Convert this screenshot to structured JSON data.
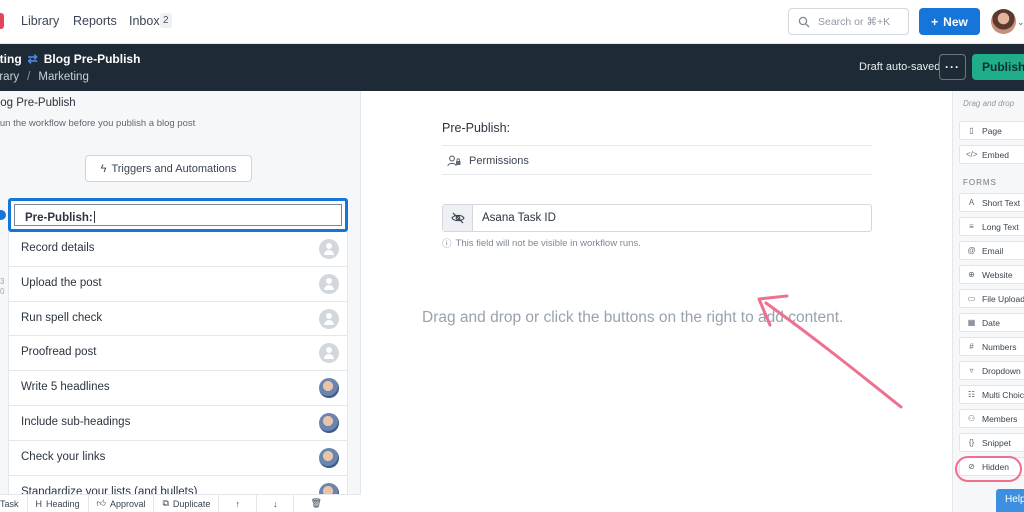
{
  "nav": {
    "links": [
      "Library",
      "Reports",
      "Inbox"
    ],
    "inbox_count": "2",
    "search_placeholder": "Search or ⌘+K",
    "new_label": "New"
  },
  "header": {
    "mode_label": "Editing",
    "workflow_name": "Blog Pre-Publish",
    "breadcrumb": [
      "Library",
      "Marketing"
    ],
    "status": "Draft auto-saved",
    "more_label": "···",
    "publish_label": "Publish"
  },
  "left_panel": {
    "title": "Blog Pre-Publish",
    "description": "Run the workflow before you publish a blog post",
    "triggers_label": "Triggers and Automations",
    "tasks": [
      {
        "label": "Pre-Publish:",
        "active": true,
        "assignee": "none"
      },
      {
        "label": "Record details",
        "active": false,
        "assignee": "empty"
      },
      {
        "label": "Upload the post",
        "active": false,
        "assignee": "empty"
      },
      {
        "label": "Run spell check",
        "active": false,
        "assignee": "empty"
      },
      {
        "label": "Proofread post",
        "active": false,
        "assignee": "empty"
      },
      {
        "label": "Write 5 headlines",
        "active": false,
        "assignee": "photo"
      },
      {
        "label": "Include sub-headings",
        "active": false,
        "assignee": "photo"
      },
      {
        "label": "Check your links",
        "active": false,
        "assignee": "photo"
      },
      {
        "label": "Standardize your lists (and bullets)",
        "active": false,
        "assignee": "photo"
      }
    ],
    "toolbar": [
      "Task",
      "Heading",
      "Approval",
      "Duplicate"
    ]
  },
  "canvas": {
    "task_title": "Pre-Publish:",
    "permissions_label": "Permissions",
    "hidden_field_label": "Asana Task ID",
    "hidden_field_note": "This field will not be visible in workflow runs.",
    "drop_hint": "Drag and drop or click the buttons on the right to add content."
  },
  "right_panel": {
    "hint": "Drag and drop",
    "content_items": [
      {
        "label": "Page",
        "icon": "page-icon"
      },
      {
        "label": "Embed",
        "icon": "code-icon"
      }
    ],
    "forms_heading": "FORMS",
    "form_items": [
      {
        "label": "Short Text",
        "icon": "text-icon"
      },
      {
        "label": "Long Text",
        "icon": "paragraph-icon"
      },
      {
        "label": "Email",
        "icon": "at-icon"
      },
      {
        "label": "Website",
        "icon": "globe-icon"
      },
      {
        "label": "File Upload",
        "icon": "file-icon"
      },
      {
        "label": "Date",
        "icon": "calendar-icon"
      },
      {
        "label": "Numbers",
        "icon": "numbers-icon"
      },
      {
        "label": "Dropdown",
        "icon": "dropdown-icon"
      },
      {
        "label": "Multi Choice",
        "icon": "multi-choice-icon"
      },
      {
        "label": "Members",
        "icon": "members-icon"
      },
      {
        "label": "Snippet",
        "icon": "snippet-icon"
      },
      {
        "label": "Hidden",
        "icon": "eye-slash-icon"
      }
    ],
    "help_label": "Help"
  },
  "colors": {
    "accent": "#1675d9",
    "publish": "#1fae8a",
    "header_bg": "#1e2a35",
    "annotation": "#ee6f8e"
  }
}
